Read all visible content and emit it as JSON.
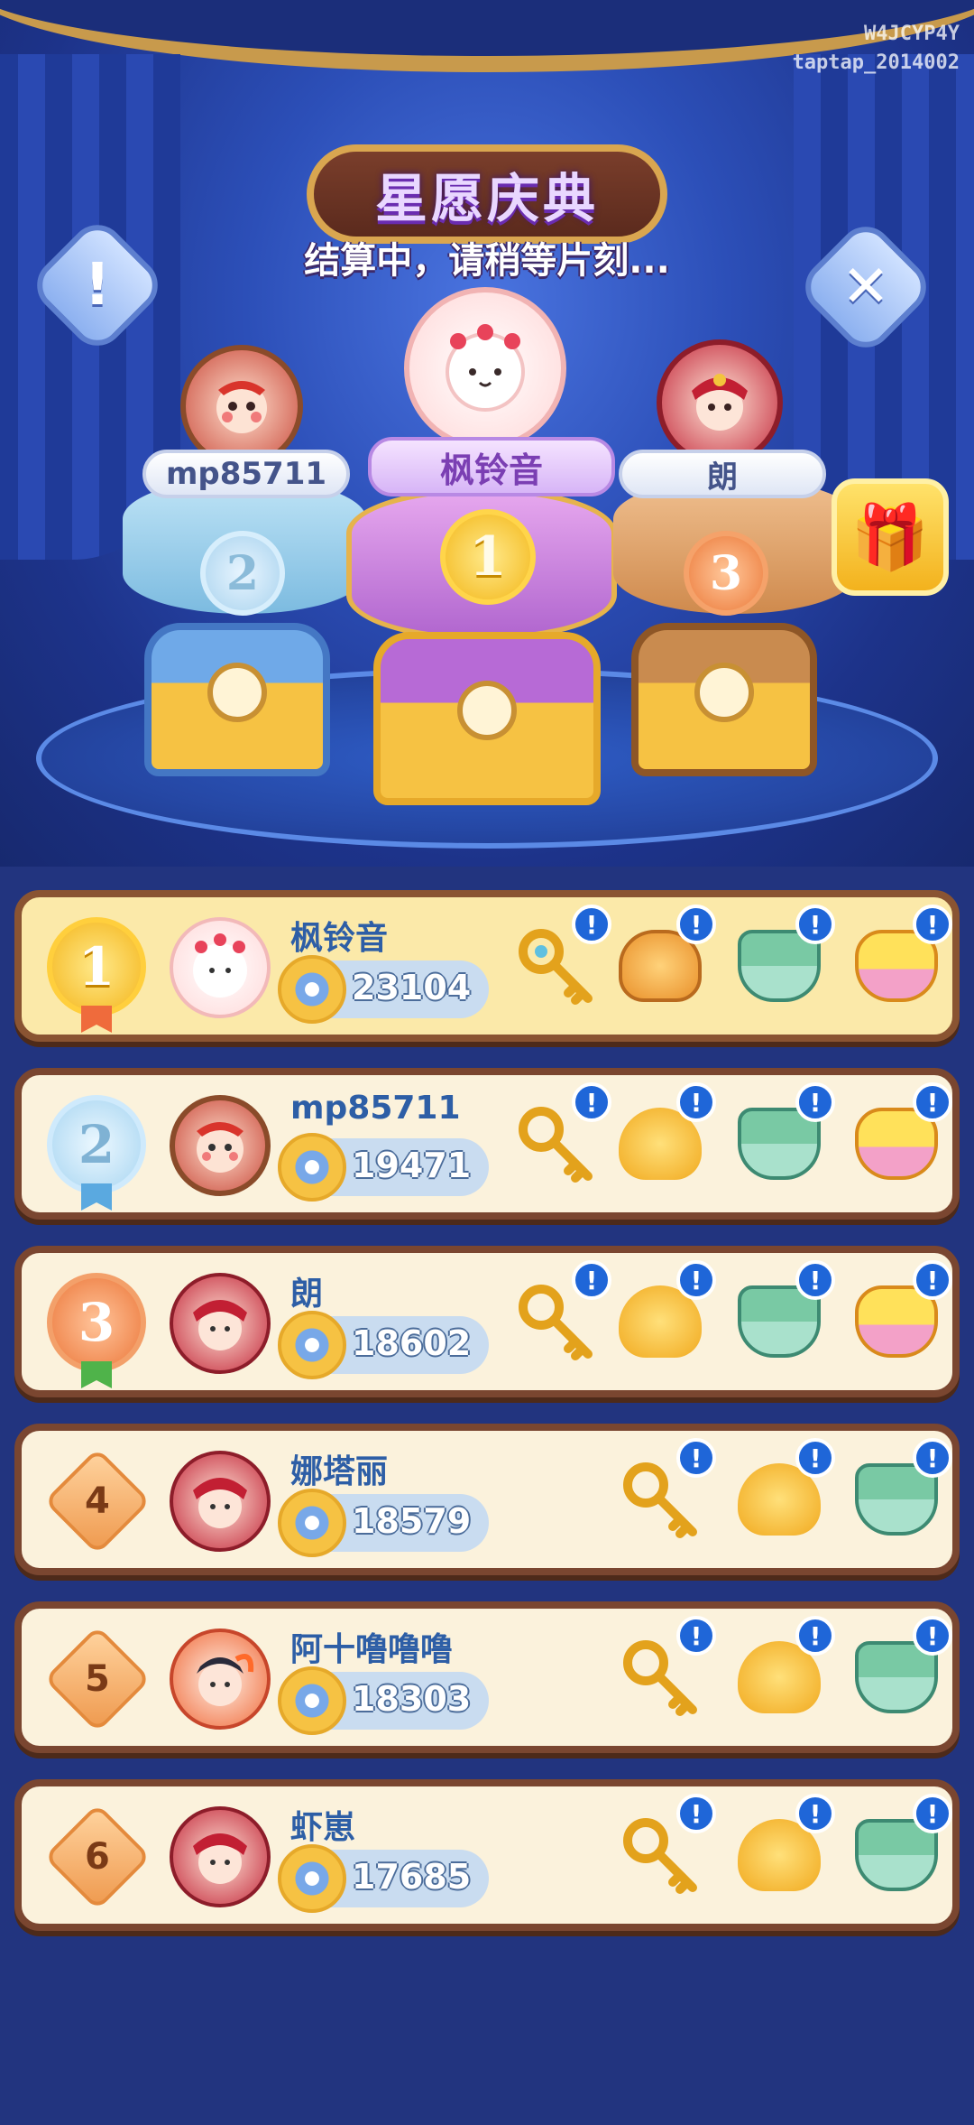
{
  "watermark": {
    "line1": "W4JCYP4Y",
    "line2": "taptap_2014002"
  },
  "header": {
    "title": "星愿庆典",
    "subtitle": "结算中，请稍等片刻..."
  },
  "buttons": {
    "info_glyph": "!",
    "close_glyph": "✕",
    "gift_glyph": "🎁"
  },
  "podium": [
    {
      "rank": "2",
      "name": "mp85711"
    },
    {
      "rank": "1",
      "name": "枫铃音"
    },
    {
      "rank": "3",
      "name": "朗"
    }
  ],
  "rankings": [
    {
      "rank": "1",
      "name": "枫铃音",
      "score": "23104",
      "rewards": [
        "key-icon",
        "dumpling-icon",
        "pot-icon",
        "gold-ingot-icon"
      ]
    },
    {
      "rank": "2",
      "name": "mp85711",
      "score": "19471",
      "rewards": [
        "key-icon",
        "bag-icon",
        "pot-icon",
        "gold-ingot-icon"
      ]
    },
    {
      "rank": "3",
      "name": "朗",
      "score": "18602",
      "rewards": [
        "key-icon",
        "bag-icon",
        "pot-icon",
        "gold-ingot-icon"
      ]
    },
    {
      "rank": "4",
      "name": "娜塔丽",
      "score": "18579",
      "rewards": [
        "key-icon",
        "bag-icon",
        "pot-icon"
      ]
    },
    {
      "rank": "5",
      "name": "阿十噜噜噜",
      "score": "18303",
      "rewards": [
        "key-icon",
        "bag-icon",
        "pot-icon"
      ]
    },
    {
      "rank": "6",
      "name": "虾崽",
      "score": "17685",
      "rewards": [
        "key-icon",
        "bag-icon",
        "pot-icon"
      ]
    }
  ],
  "info_glyph": "!",
  "colors": {
    "background": "#22347f",
    "name_text": "#2d5ea6",
    "row_border": "#7a4630",
    "row_bg": "#fbf2dc",
    "first_row_bg": "#fbe9a9"
  }
}
